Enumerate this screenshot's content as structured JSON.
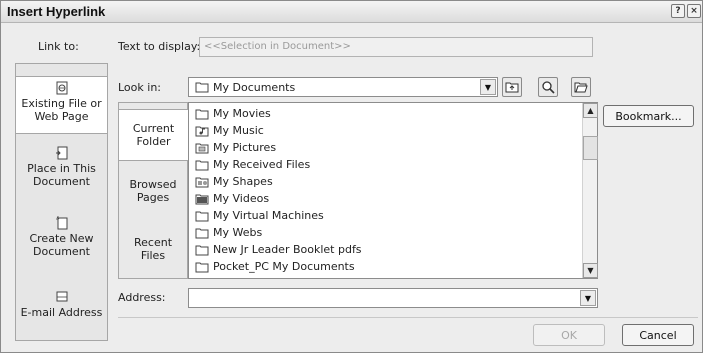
{
  "window": {
    "title": "Insert Hyperlink",
    "help_glyph": "?",
    "close_glyph": "×"
  },
  "link_to": {
    "label": "Link to:",
    "items": [
      {
        "line1": "Existing File or",
        "line2": "Web Page"
      },
      {
        "line1": "Place in This",
        "line2": "Document"
      },
      {
        "line1": "Create New",
        "line2": "Document"
      },
      {
        "line1": "E-mail Address",
        "line2": ""
      }
    ]
  },
  "text_to_display": {
    "label": "Text to display:",
    "value": "<<Selection in Document>>"
  },
  "look_in": {
    "label": "Look in:",
    "value": "My Documents"
  },
  "folder_tabs": [
    {
      "line1": "Current",
      "line2": "Folder"
    },
    {
      "line1": "Browsed",
      "line2": "Pages"
    },
    {
      "line1": "Recent",
      "line2": "Files"
    }
  ],
  "files": [
    {
      "name": "My Movies",
      "icon": "folder-icon"
    },
    {
      "name": "My Music",
      "icon": "music-folder-icon"
    },
    {
      "name": "My Pictures",
      "icon": "pictures-folder-icon"
    },
    {
      "name": "My Received Files",
      "icon": "folder-icon"
    },
    {
      "name": "My Shapes",
      "icon": "shapes-folder-icon"
    },
    {
      "name": "My Videos",
      "icon": "video-folder-icon"
    },
    {
      "name": "My Virtual Machines",
      "icon": "folder-icon"
    },
    {
      "name": "My Webs",
      "icon": "folder-icon"
    },
    {
      "name": "New Jr Leader Booklet pdfs",
      "icon": "folder-icon"
    },
    {
      "name": "Pocket_PC My Documents",
      "icon": "folder-icon"
    }
  ],
  "address": {
    "label": "Address:",
    "value": ""
  },
  "buttons": {
    "bookmark": "Bookmark...",
    "ok": "OK",
    "cancel": "Cancel"
  }
}
